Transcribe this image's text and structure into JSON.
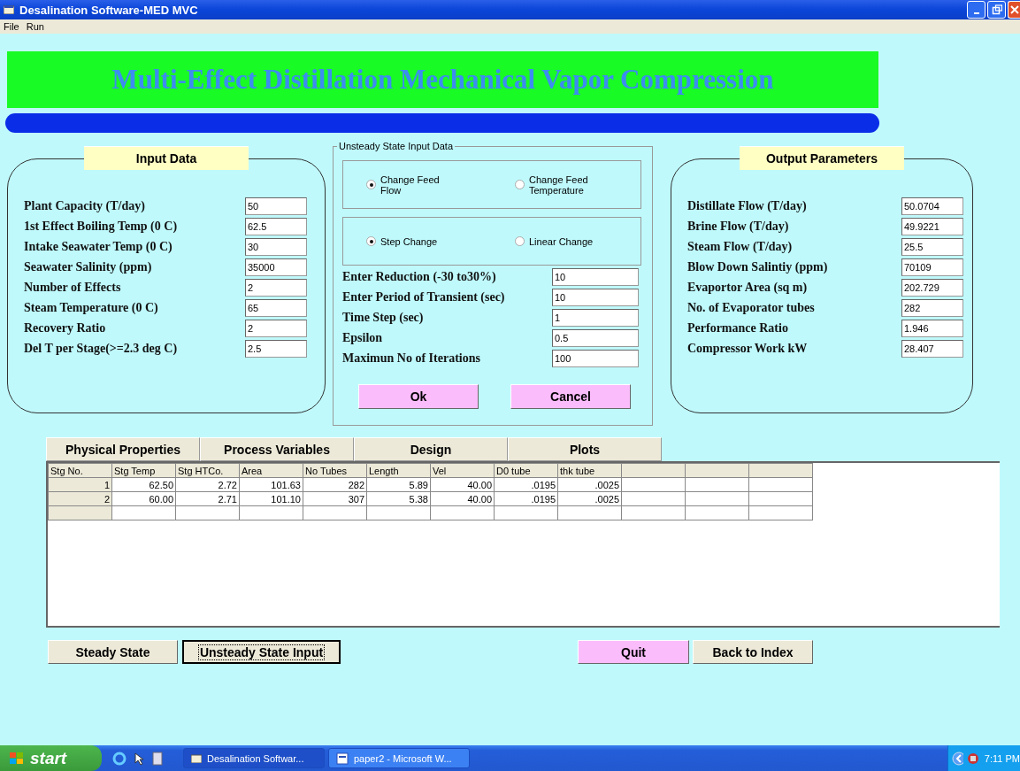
{
  "window": {
    "title": "Desalination Software-MED MVC"
  },
  "menu": [
    "File",
    "Run"
  ],
  "banner": {
    "title": "Multi-Effect Distillation Mechanical Vapor Compression"
  },
  "input_data": {
    "heading": "Input Data",
    "fields": [
      {
        "label": "Plant Capacity (T/day)",
        "value": "50"
      },
      {
        "label": "1st Effect Boiling Temp (0 C)",
        "value": "62.5"
      },
      {
        "label": "Intake Seawater Temp (0 C)",
        "value": "30"
      },
      {
        "label": "Seawater Salinity (ppm)",
        "value": "35000"
      },
      {
        "label": "Number of Effects",
        "value": "2"
      },
      {
        "label": "Steam Temperature (0 C)",
        "value": "65"
      },
      {
        "label": "Recovery Ratio",
        "value": "2"
      },
      {
        "label": "Del T per Stage(>=2.3 deg C)",
        "value": "2.5"
      }
    ]
  },
  "unsteady": {
    "legend": "Unsteady State Input Data",
    "radio_groups": [
      [
        {
          "label": "Change Feed Flow",
          "selected": true
        },
        {
          "label": "Change Feed Temperature",
          "selected": false
        }
      ],
      [
        {
          "label": "Step Change",
          "selected": true
        },
        {
          "label": "Linear Change",
          "selected": false
        }
      ]
    ],
    "fields": [
      {
        "label": "Enter Reduction (-30 to30%)",
        "value": "10"
      },
      {
        "label": "Enter Period of Transient (sec)",
        "value": "10"
      },
      {
        "label": "Time Step (sec)",
        "value": "1"
      },
      {
        "label": "Epsilon",
        "value": "0.5"
      },
      {
        "label": "Maximun No of Iterations",
        "value": "100"
      }
    ],
    "buttons": [
      "Ok",
      "Cancel"
    ]
  },
  "output": {
    "heading": "Output Parameters",
    "fields": [
      {
        "label": "Distillate Flow (T/day)",
        "value": "50.0704"
      },
      {
        "label": "Brine Flow (T/day)",
        "value": "49.9221"
      },
      {
        "label": "Steam Flow (T/day)",
        "value": "25.5"
      },
      {
        "label": "Blow Down Salintiy (ppm)",
        "value": "70109"
      },
      {
        "label": "Evaportor Area (sq m)",
        "value": "202.729"
      },
      {
        "label": "No. of Evaporator tubes",
        "value": "282"
      },
      {
        "label": "Performance Ratio",
        "value": "1.946"
      },
      {
        "label": "Compressor Work kW",
        "value": "28.407"
      }
    ]
  },
  "tabs": [
    "Physical Properties",
    "Process Variables",
    "Design",
    "Plots"
  ],
  "table": {
    "columns": [
      "Stg No.",
      "Stg Temp",
      "Stg HTCo.",
      "Area",
      "No Tubes",
      "Length",
      "Vel",
      "D0 tube",
      "thk tube"
    ],
    "rows": [
      [
        "1",
        "62.50",
        "2.72",
        "101.63",
        "282",
        "5.89",
        "40.00",
        ".0195",
        ".0025"
      ],
      [
        "2",
        "60.00",
        "2.71",
        "101.10",
        "307",
        "5.38",
        "40.00",
        ".0195",
        ".0025"
      ]
    ]
  },
  "buttons": [
    {
      "label": "Steady State",
      "kind": "grey",
      "focused": false
    },
    {
      "label": "Unsteady State Input",
      "kind": "grey",
      "focused": true
    },
    {
      "label": "Quit",
      "kind": "pink",
      "focused": false
    },
    {
      "label": "Back to Index",
      "kind": "grey",
      "focused": false
    }
  ],
  "taskbar": {
    "start": "start",
    "tasks": [
      {
        "label": "Desalination Softwar...",
        "kind": "app"
      },
      {
        "label": "paper2 - Microsoft W...",
        "kind": "doc"
      }
    ],
    "clock": "7:11 PM"
  }
}
